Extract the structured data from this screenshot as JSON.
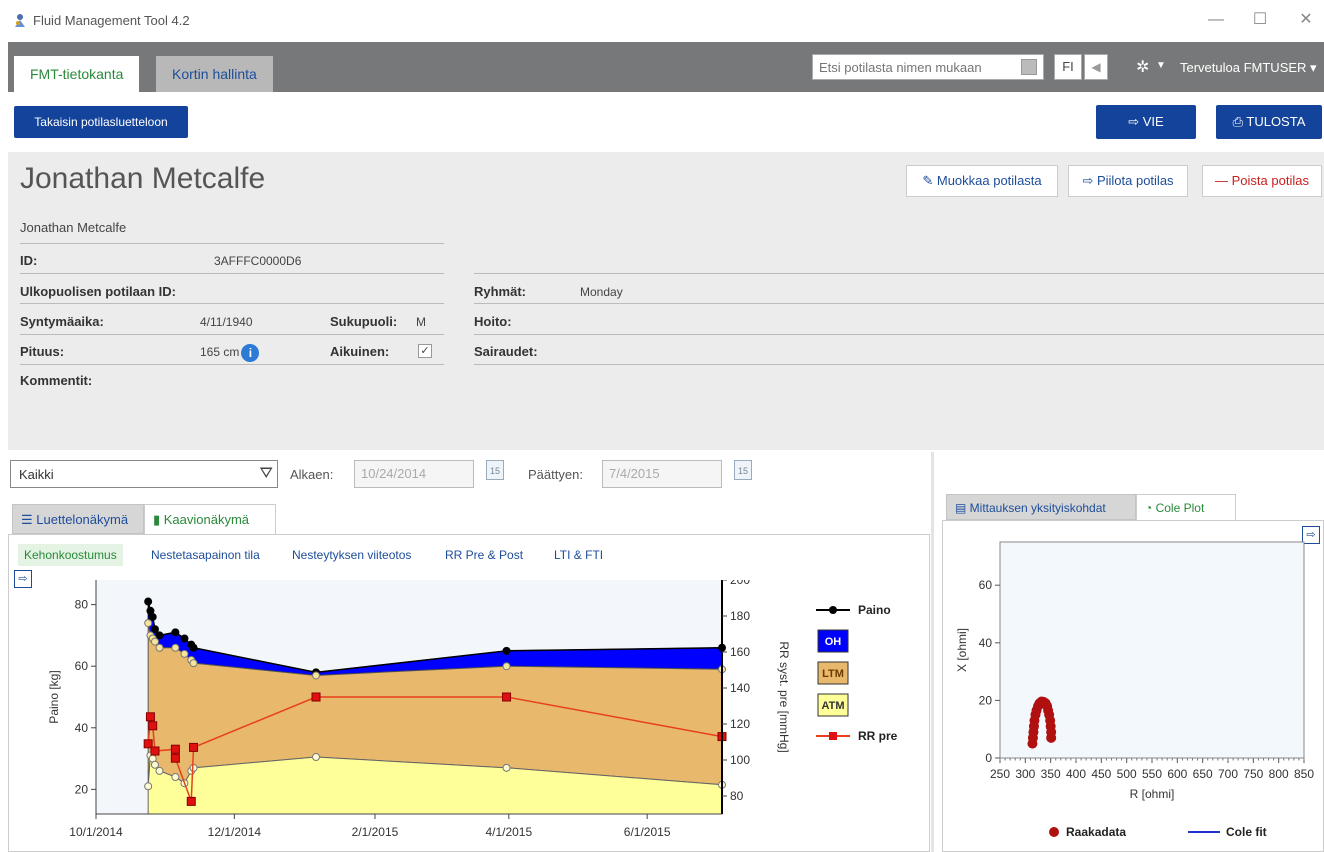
{
  "window": {
    "title": "Fluid Management Tool 4.2",
    "minimize": "—",
    "maximize": "☐",
    "close": "✕"
  },
  "topnav": {
    "tabs": [
      {
        "label": "FMT-tietokanta"
      },
      {
        "label": "Kortin hallinta"
      }
    ],
    "search_placeholder": "Etsi potilasta nimen mukaan",
    "language": "FI",
    "welcome": "Tervetuloa FMTUSER ▾"
  },
  "toolbar": {
    "back_label": "Takaisin potilasluetteloon",
    "export_label": "VIE",
    "print_label": "TULOSTA"
  },
  "patient": {
    "name": "Jonathan Metcalfe",
    "subname": "Jonathan Metcalfe",
    "actions": {
      "edit": "Muokkaa potilasta",
      "hide": "Piilota potilas",
      "delete": "Poista potilas"
    },
    "fields": {
      "id_label": "ID:",
      "id_value": "3AFFFC0000D6",
      "ext_id_label": "Ulkopuolisen potilaan ID:",
      "dob_label": "Syntymäaika:",
      "dob_value": "4/11/1940",
      "sex_label": "Sukupuoli:",
      "sex_value": "M",
      "height_label": "Pituus:",
      "height_value": "165 cm",
      "adult_label": "Aikuinen:",
      "comments_label": "Kommentit:",
      "groups_label": "Ryhmät:",
      "groups_value": "Monday",
      "treatment_label": "Hoito:",
      "diseases_label": "Sairaudet:"
    },
    "adult_checked": true
  },
  "filter": {
    "select_value": "Kaikki",
    "from_label": "Alkaen:",
    "from_value": "10/24/2014",
    "to_label": "Päättyen:",
    "to_value": "7/4/2015",
    "cal_day": "15"
  },
  "views": {
    "tabs": [
      {
        "label": "Luettelonäkymä"
      },
      {
        "label": "Kaavionäkymä"
      }
    ],
    "subtabs": [
      {
        "label": "Kehonkoostumus"
      },
      {
        "label": "Nestetasapainon tila"
      },
      {
        "label": "Nesteytyksen viiteotos"
      },
      {
        "label": "RR Pre & Post"
      },
      {
        "label": "LTI & FTI"
      }
    ]
  },
  "right_panel": {
    "tabs": [
      {
        "label": "Mittauksen yksityiskohdat"
      },
      {
        "label": "Cole Plot"
      }
    ]
  },
  "chart_data": [
    {
      "type": "area",
      "ylabel": "Paino [kg]",
      "y2label": "RR syst. pre [mmHg]",
      "xlim": [
        "2014-10-01",
        "2015-07-04"
      ],
      "ylim": [
        12,
        88
      ],
      "y2lim": [
        70,
        200
      ],
      "x_ticks": [
        "10/1/2014",
        "12/1/2014",
        "2/1/2015",
        "4/1/2015",
        "6/1/2015"
      ],
      "y_ticks": [
        20,
        40,
        60,
        80
      ],
      "y2_ticks": [
        80,
        100,
        120,
        140,
        160,
        180,
        200
      ],
      "x": [
        "2014-10-24",
        "2014-10-25",
        "2014-10-26",
        "2014-10-27",
        "2014-10-29",
        "2014-11-05",
        "2014-11-09",
        "2014-11-12",
        "2014-11-13",
        "2015-01-06",
        "2015-03-31",
        "2015-07-04"
      ],
      "series": [
        {
          "name": "Paino",
          "color": "#000000",
          "values": [
            81,
            78,
            76,
            72,
            70,
            71,
            69,
            67,
            66,
            58,
            65,
            66
          ]
        },
        {
          "name": "LTM",
          "color": "#e8b86d",
          "values": [
            74,
            70,
            69,
            68,
            66,
            66,
            64,
            62,
            61,
            57,
            60,
            59
          ]
        },
        {
          "name": "ATM",
          "color": "#ffff99",
          "values": [
            21,
            31,
            30,
            28,
            26,
            24,
            22,
            26,
            27,
            30.5,
            27,
            21.5
          ]
        },
        {
          "name": "RR pre",
          "color": "#e8401c",
          "axis": "right",
          "values": [
            109,
            124,
            119,
            105,
            null,
            106,
            null,
            null,
            107,
            135,
            135,
            113
          ]
        }
      ],
      "rr_extra": [
        {
          "x": "2014-11-05",
          "y": 101
        },
        {
          "x": "2014-11-12",
          "y": 77
        }
      ],
      "oh_color": "#0000ff",
      "legend": [
        {
          "name": "Paino",
          "kind": "line"
        },
        {
          "name": "OH",
          "kind": "box",
          "color": "#0000ff",
          "text_color": "#ffffff"
        },
        {
          "name": "LTM",
          "kind": "box",
          "color": "#e8b86d",
          "text_color": "#6b3a00"
        },
        {
          "name": "ATM",
          "kind": "box",
          "color": "#ffff99",
          "text_color": "#333333"
        },
        {
          "name": "RR pre",
          "kind": "line-marker",
          "color": "#e8401c"
        }
      ],
      "legend_placement": "right"
    },
    {
      "type": "scatter",
      "xlabel": "R [ohmi]",
      "ylabel": "X [ohmi]",
      "xlim": [
        250,
        850
      ],
      "ylim": [
        0,
        75
      ],
      "x_ticks": [
        250,
        300,
        350,
        400,
        450,
        500,
        550,
        600,
        650,
        700,
        750,
        800,
        850
      ],
      "y_ticks": [
        0,
        20,
        40,
        60
      ],
      "series": [
        {
          "name": "Raakadata",
          "color": "#b01010",
          "points": [
            [
              314,
              5
            ],
            [
              315,
              7
            ],
            [
              316,
              9
            ],
            [
              317,
              11
            ],
            [
              318,
              13
            ],
            [
              320,
              15
            ],
            [
              322,
              16.5
            ],
            [
              325,
              18
            ],
            [
              328,
              19
            ],
            [
              332,
              19.6
            ],
            [
              336,
              19.5
            ],
            [
              340,
              19
            ],
            [
              343,
              18
            ],
            [
              345,
              16.5
            ],
            [
              347,
              15
            ],
            [
              349,
              13
            ],
            [
              350,
              11
            ],
            [
              351,
              9
            ],
            [
              351,
              7
            ]
          ]
        },
        {
          "name": "Cole fit",
          "color": "#2030d0"
        }
      ],
      "legend_placement": "bottom"
    }
  ]
}
